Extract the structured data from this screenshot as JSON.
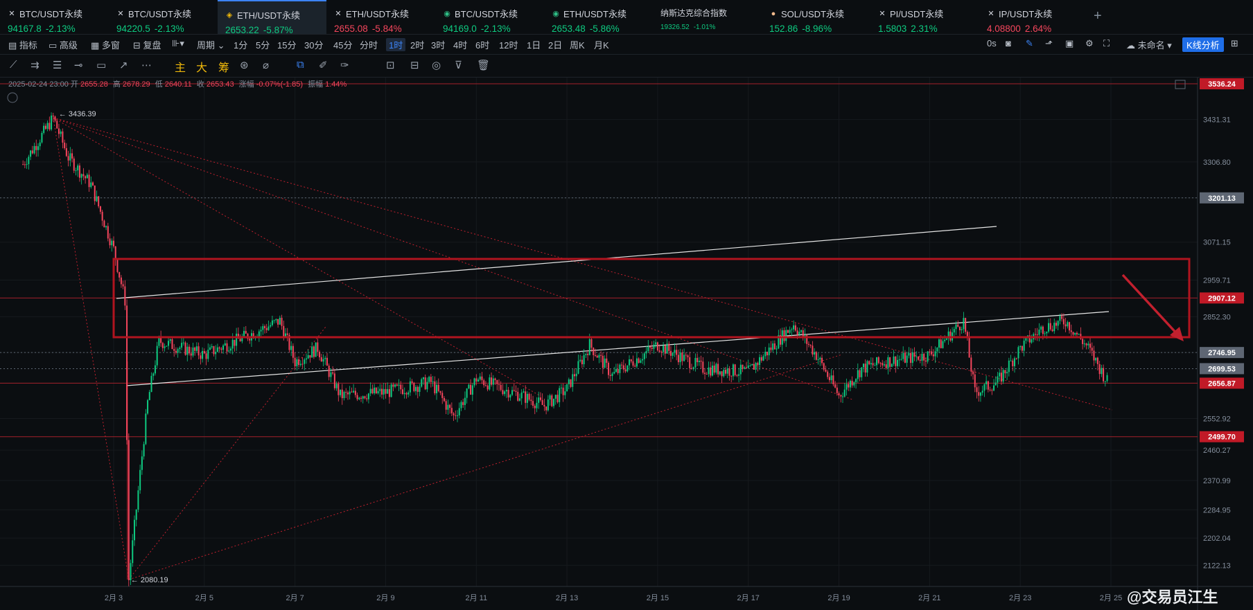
{
  "tabs": [
    {
      "name": "BTC/USDT永续",
      "icon": "close-icon",
      "price": "94167.8",
      "change": "-2.13%",
      "color": "up"
    },
    {
      "name": "BTC/USDT永续",
      "icon": "close-icon",
      "price": "94220.5",
      "change": "-2.13%",
      "color": "up"
    },
    {
      "name": "ETH/USDT永续",
      "icon": "binance-logo-icon",
      "price": "2653.22",
      "change": "-5.87%",
      "color": "up",
      "active": true
    },
    {
      "name": "ETH/USDT永续",
      "icon": "close-icon",
      "price": "2655.08",
      "change": "-5.84%",
      "color": "down"
    },
    {
      "name": "BTC/USDT永续",
      "icon": "exchange-logo-icon",
      "price": "94169.0",
      "change": "-2.13%",
      "color": "up"
    },
    {
      "name": "ETH/USDT永续",
      "icon": "exchange-logo-icon",
      "price": "2653.48",
      "change": "-5.86%",
      "color": "up"
    },
    {
      "name": "纳斯达克综合指数",
      "icon": "",
      "price": "19326.52",
      "change": "-1.01%",
      "color": "up",
      "small": true
    },
    {
      "name": "SOL/USDT永续",
      "icon": "sol-logo-icon",
      "price": "152.86",
      "change": "-8.96%",
      "color": "up"
    },
    {
      "name": "PI/USDT永续",
      "icon": "close-icon",
      "price": "1.5803",
      "change": "2.31%",
      "color": "up"
    },
    {
      "name": "IP/USDT永续",
      "icon": "close-icon",
      "price": "4.08800",
      "change": "2.64%",
      "color": "down"
    }
  ],
  "toolbar": {
    "indicators": "指标",
    "advanced": "高级",
    "multi": "多窗",
    "replay": "复盘",
    "period": "周期",
    "intervals": [
      "1分",
      "5分",
      "15分",
      "30分",
      "45分",
      "分时",
      "1时",
      "2时",
      "3时",
      "4时",
      "6时",
      "12时",
      "1日",
      "2日",
      "周K",
      "月K"
    ],
    "selected_interval": "1时",
    "countdown": "0s",
    "layout_name": "未命名",
    "k_analysis": "K线分析"
  },
  "drawbar": {
    "main": "主",
    "big": "大",
    "chips": "筹"
  },
  "info": {
    "datetime": "2025-02-24 23:00",
    "open_label": "开",
    "open": "2655.28",
    "high_label": "高",
    "high": "2678.29",
    "low_label": "低",
    "low": "2640.11",
    "close_label": "收",
    "close": "2653.43",
    "change_label": "涨幅",
    "change": "-0.07%(-1.85)",
    "amp_label": "振幅",
    "amp": "1.44%"
  },
  "chart_data": {
    "type": "candlestick",
    "symbol": "ETH/USDT永续",
    "interval": "1时",
    "ylim": [
      2080,
      3540
    ],
    "y_ticks": [
      3431.31,
      3306.8,
      3201.13,
      3071.15,
      2959.71,
      2852.3,
      2746.95,
      2656.87,
      2552.92,
      2460.27,
      2370.99,
      2284.95,
      2202.04,
      2122.13
    ],
    "x_ticks": [
      "2月 3",
      "2月 5",
      "2月 7",
      "2月 9",
      "2月 11",
      "2月 13",
      "2月 15",
      "2月 17",
      "2月 19",
      "2月 21",
      "2月 23",
      "2月 25"
    ],
    "price_levels": [
      {
        "label": "3536.24",
        "style": "red"
      },
      {
        "label": "3201.13",
        "style": "gray"
      },
      {
        "label": "2907.12",
        "style": "red"
      },
      {
        "label": "2746.95",
        "style": "gray"
      },
      {
        "label": "2699.53",
        "style": "gray"
      },
      {
        "label": "2656.87",
        "style": "red"
      },
      {
        "label": "2499.70",
        "style": "red"
      }
    ],
    "annotations": {
      "high": "3436.39",
      "low": "2080.19"
    },
    "trend": [
      {
        "x": "2月 1",
        "y": 3300
      },
      {
        "x": "2月 1 16时",
        "y": 3436
      },
      {
        "x": "2月 2",
        "y": 3320
      },
      {
        "x": "2月 2 12时",
        "y": 3240
      },
      {
        "x": "2月 3",
        "y": 3050
      },
      {
        "x": "2月 3 06时",
        "y": 2900
      },
      {
        "x": "2月 3 08时",
        "y": 2080
      },
      {
        "x": "2月 3 18时",
        "y": 2600
      },
      {
        "x": "2月 4",
        "y": 2780
      },
      {
        "x": "2月 5",
        "y": 2740
      },
      {
        "x": "2月 6",
        "y": 2800
      },
      {
        "x": "2月 6 16时",
        "y": 2840
      },
      {
        "x": "2月 7",
        "y": 2720
      },
      {
        "x": "2月 7 12时",
        "y": 2760
      },
      {
        "x": "2月 8",
        "y": 2620
      },
      {
        "x": "2月 9",
        "y": 2630
      },
      {
        "x": "2月 10",
        "y": 2660
      },
      {
        "x": "2月 10 12时",
        "y": 2560
      },
      {
        "x": "2月 11",
        "y": 2670
      },
      {
        "x": "2月 12",
        "y": 2620
      },
      {
        "x": "2月 12 12时",
        "y": 2590
      },
      {
        "x": "2月 13",
        "y": 2640
      },
      {
        "x": "2月 13 12时",
        "y": 2770
      },
      {
        "x": "2月 14",
        "y": 2680
      },
      {
        "x": "2月 15",
        "y": 2770
      },
      {
        "x": "2月 16",
        "y": 2700
      },
      {
        "x": "2月 17",
        "y": 2690
      },
      {
        "x": "2月 18",
        "y": 2830
      },
      {
        "x": "2月 18 12时",
        "y": 2740
      },
      {
        "x": "2月 19",
        "y": 2620
      },
      {
        "x": "2月 19 12时",
        "y": 2700
      },
      {
        "x": "2月 20",
        "y": 2720
      },
      {
        "x": "2月 21",
        "y": 2740
      },
      {
        "x": "2月 21 18时",
        "y": 2840
      },
      {
        "x": "2月 22",
        "y": 2630
      },
      {
        "x": "2月 22 12时",
        "y": 2660
      },
      {
        "x": "2月 23",
        "y": 2760
      },
      {
        "x": "2月 23 12时",
        "y": 2820
      },
      {
        "x": "2月 24",
        "y": 2840
      },
      {
        "x": "2月 24 12时",
        "y": 2760
      },
      {
        "x": "2月 24 23时",
        "y": 2653
      }
    ]
  },
  "watermark": "@交易员江生",
  "colors": {
    "up": "#0ecb81",
    "down": "#f6465d",
    "accent": "#3c84f7",
    "level_red": "#c2202e"
  }
}
